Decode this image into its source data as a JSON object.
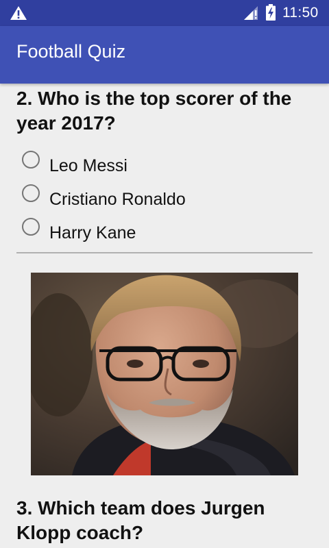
{
  "status_bar": {
    "time": "11:50",
    "icons": [
      "warning-icon",
      "signal-icon",
      "battery-charging-icon"
    ]
  },
  "app_bar": {
    "title": "Football Quiz"
  },
  "questions": [
    {
      "text": "2. Who is the top scorer of the year 2017?",
      "options": [
        "Leo Messi",
        "Cristiano Ronaldo",
        "Harry Kane"
      ]
    },
    {
      "text": "3. Which team does Jurgen Klopp coach?"
    }
  ],
  "colors": {
    "status_bar": "#303f9f",
    "app_bar": "#3f51b5",
    "background": "#eeeeee"
  }
}
